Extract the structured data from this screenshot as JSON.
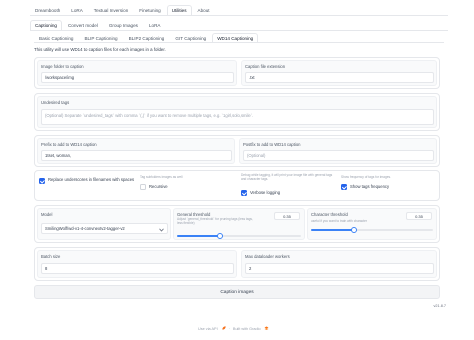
{
  "top_tabs": [
    "Dreambooth",
    "LoRA",
    "Textual Inversion",
    "Finetuning",
    "Utilities",
    "About"
  ],
  "top_active": 4,
  "sub_tabs": [
    "Captioning",
    "Convert model",
    "Group Images",
    "LoRA"
  ],
  "sub_active": 0,
  "cap_tabs": [
    "Basic Captioning",
    "BLIP Captioning",
    "BLIP2 Captioning",
    "GIT Captioning",
    "WD14 Captioning"
  ],
  "cap_active": 4,
  "info": "This utility will use WD14 to caption files for each images in a folder.",
  "image_folder": {
    "label": "Image folder to caption",
    "value": "/workspace/img"
  },
  "caption_ext": {
    "label": "Caption file extension",
    "value": ".txt"
  },
  "undesired": {
    "label": "Undesired tags",
    "placeholder": "(Optional) Separate `undesired_tags` with comma `(,)` if you want to remove multiple tags, e.g. `1girl,solo,smile`."
  },
  "prefix": {
    "label": "Prefix to add to WD14 caption",
    "value": "1tset, woman,"
  },
  "postfix": {
    "label": "Postfix to add to WD14 caption",
    "placeholder": "(Optional)"
  },
  "replace_underscores": {
    "label": "Replace underscores in filenames with spaces",
    "checked": true
  },
  "recursive": {
    "hint": "Tag subfolders images as well",
    "label": "Recursive",
    "checked": false
  },
  "verbose": {
    "hint": "Debug while tagging, it will print your image file with general tags and character tags.",
    "label": "Verbose logging",
    "checked": true
  },
  "show_freq": {
    "hint": "Show frequency of tags for images.",
    "label": "Show tags frequency",
    "checked": true
  },
  "model": {
    "label": "Model",
    "value": "SmilingWolf/wd-v1-4-convnextv2-tagger-v2"
  },
  "general_threshold": {
    "label": "General threshold",
    "hint": "Adjust `general_threshold` for pruning tags (less tags, less flexible)",
    "value": "0.35",
    "fraction": 0.35
  },
  "character_threshold": {
    "label": "Character threshold",
    "hint": "useful if you want to train with character",
    "value": "0.35",
    "fraction": 0.35
  },
  "batch_size": {
    "label": "Batch size",
    "value": "8"
  },
  "max_workers": {
    "label": "Max dataloader workers",
    "value": "2"
  },
  "caption_button": "Caption images",
  "version": "v21.8.7",
  "footer": {
    "api": "Use via API",
    "built": "Built with Gradio",
    "separator": "·"
  },
  "colors": {
    "accent": "#2563eb",
    "slider": "#3b82f6",
    "border": "#e5e7eb",
    "block_bg": "#f9fafb"
  },
  "icons": {
    "api": "rocket-icon",
    "gradio": "gradio-logo-icon",
    "dropdown": "chevron-down-icon"
  }
}
